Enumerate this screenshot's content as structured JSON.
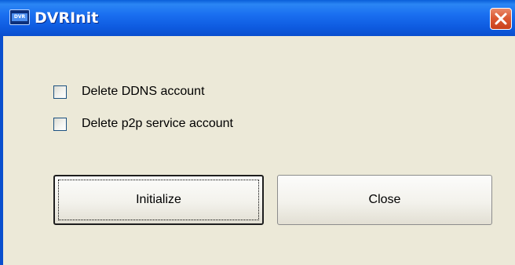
{
  "window": {
    "title": "DVRInit",
    "app_icon_text": "DVR",
    "title_color": "#1a6ff0",
    "close_color": "#dc5a34"
  },
  "options": [
    {
      "label": "Delete DDNS account",
      "checked": false
    },
    {
      "label": "Delete p2p service account",
      "checked": false
    }
  ],
  "buttons": {
    "initialize_label": "Initialize",
    "close_label": "Close"
  },
  "icons": {
    "window_icon": "dvr-app-icon",
    "close": "close-icon"
  }
}
